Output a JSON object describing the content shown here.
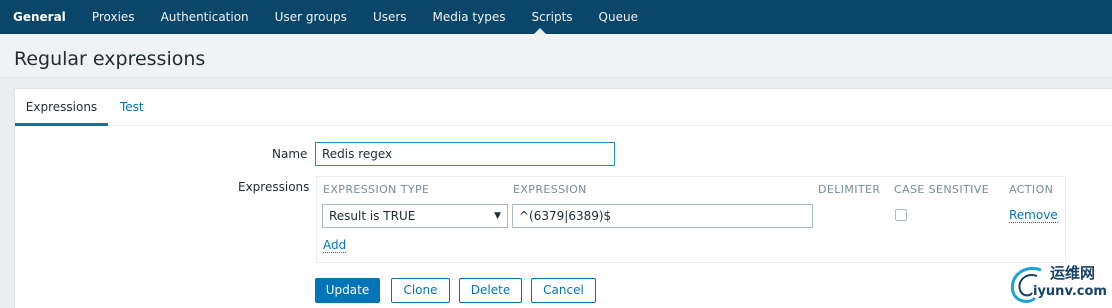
{
  "topnav": {
    "items": [
      {
        "label": "General",
        "active": true
      },
      {
        "label": "Proxies"
      },
      {
        "label": "Authentication"
      },
      {
        "label": "User groups"
      },
      {
        "label": "Users"
      },
      {
        "label": "Media types"
      },
      {
        "label": "Scripts"
      },
      {
        "label": "Queue"
      }
    ],
    "background": "#0a466a"
  },
  "header": {
    "title": "Regular expressions"
  },
  "tabs": [
    {
      "label": "Expressions",
      "active": true
    },
    {
      "label": "Test"
    }
  ],
  "form": {
    "name_label": "Name",
    "name_value": "Redis regex",
    "expressions_label": "Expressions",
    "columns": [
      "EXPRESSION TYPE",
      "EXPRESSION",
      "DELIMITER",
      "CASE SENSITIVE",
      "ACTION"
    ],
    "rows": [
      {
        "type": "Result is TRUE",
        "expression": "^(6379|6389)$",
        "case_sensitive": false,
        "action": "Remove"
      }
    ],
    "add_label": "Add"
  },
  "buttons": {
    "update": "Update",
    "clone": "Clone",
    "delete": "Delete",
    "cancel": "Cancel"
  },
  "watermark": {
    "line1": "运维网",
    "line2": "iyunv.com"
  },
  "colors": {
    "accent": "#0275b8",
    "nav": "#0a466a",
    "page_bg": "#ebeef0"
  }
}
